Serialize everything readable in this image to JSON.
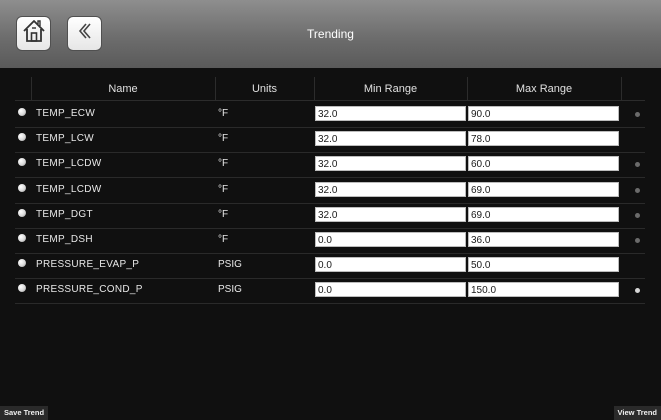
{
  "header": {
    "title": "Trending"
  },
  "table": {
    "columns": {
      "name": "Name",
      "units": "Units",
      "min": "Min Range",
      "max": "Max Range"
    },
    "rows": [
      {
        "name": "TEMP_ECW",
        "units": "°F",
        "min": "32.0",
        "max": "90.0",
        "indicator": "dim"
      },
      {
        "name": "TEMP_LCW",
        "units": "°F",
        "min": "32.0",
        "max": "78.0",
        "indicator": ""
      },
      {
        "name": "TEMP_LCDW",
        "units": "°F",
        "min": "32.0",
        "max": "60.0",
        "indicator": "dim"
      },
      {
        "name": "TEMP_LCDW",
        "units": "°F",
        "min": "32.0",
        "max": "69.0",
        "indicator": "dim"
      },
      {
        "name": "TEMP_DGT",
        "units": "°F",
        "min": "32.0",
        "max": "69.0",
        "indicator": "dim"
      },
      {
        "name": "TEMP_DSH",
        "units": "°F",
        "min": "0.0",
        "max": "36.0",
        "indicator": "dim"
      },
      {
        "name": "PRESSURE_EVAP_P",
        "units": "PSIG",
        "min": "0.0",
        "max": "50.0",
        "indicator": ""
      },
      {
        "name": "PRESSURE_COND_P",
        "units": "PSIG",
        "min": "0.0",
        "max": "150.0",
        "indicator": "bright"
      }
    ]
  },
  "footer": {
    "save_label": "Save Trend",
    "view_label": "View Trend"
  }
}
